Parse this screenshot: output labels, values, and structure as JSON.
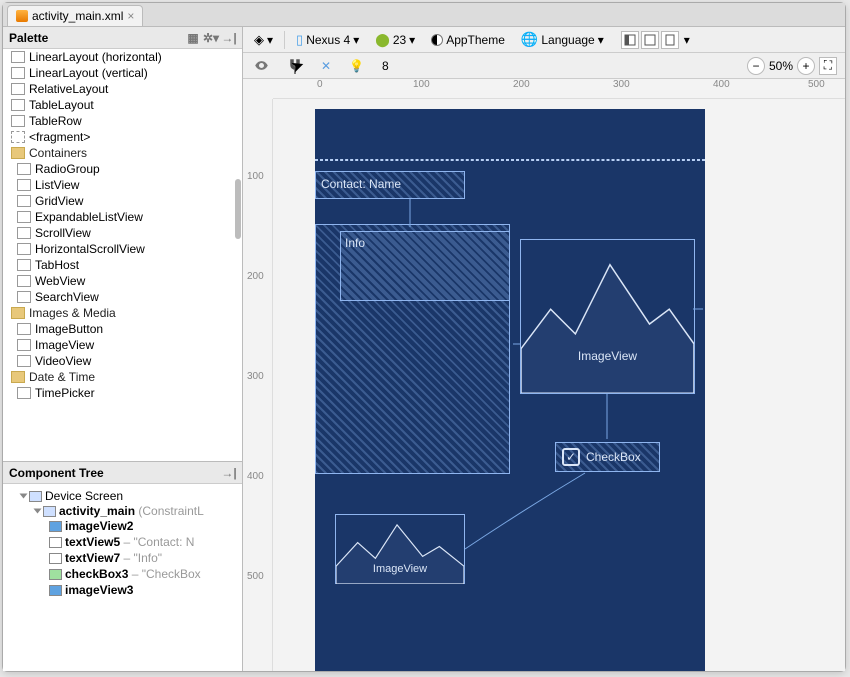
{
  "tab": {
    "filename": "activity_main.xml"
  },
  "palette": {
    "title": "Palette",
    "items": [
      {
        "label": "LinearLayout (horizontal)",
        "icon": "layout"
      },
      {
        "label": "LinearLayout (vertical)",
        "icon": "layout"
      },
      {
        "label": "RelativeLayout",
        "icon": "layout"
      },
      {
        "label": "TableLayout",
        "icon": "layout"
      },
      {
        "label": "TableRow",
        "icon": "layout"
      },
      {
        "label": "<fragment>",
        "icon": "dev"
      }
    ],
    "groups": [
      {
        "group": "Containers",
        "items": [
          "RadioGroup",
          "ListView",
          "GridView",
          "ExpandableListView",
          "ScrollView",
          "HorizontalScrollView",
          "TabHost",
          "WebView",
          "SearchView"
        ]
      },
      {
        "group": "Images & Media",
        "items": [
          "ImageButton",
          "ImageView",
          "VideoView"
        ]
      },
      {
        "group": "Date & Time",
        "items": [
          "TimePicker"
        ]
      }
    ]
  },
  "toolbar": {
    "device": "Nexus 4",
    "api": "23",
    "theme": "AppTheme",
    "language": "Language",
    "autoconnect_margin": "8",
    "zoom": "50%"
  },
  "component_tree": {
    "title": "Component Tree",
    "root": "Device Screen",
    "layout": "activity_main",
    "layout_type": "(ConstraintL",
    "children": [
      {
        "id": "imageView2",
        "type": "img",
        "sub": ""
      },
      {
        "id": "textView5",
        "type": "txt",
        "sub": " – \"Contact: N"
      },
      {
        "id": "textView7",
        "type": "txt",
        "sub": " – \"Info\""
      },
      {
        "id": "checkBox3",
        "type": "chk",
        "sub": " – \"CheckBox"
      },
      {
        "id": "imageView3",
        "type": "img",
        "sub": ""
      }
    ]
  },
  "design": {
    "textview5": "Contact: Name",
    "textview7": "Info",
    "imageview_label": "ImageView",
    "checkbox_label": "CheckBox"
  },
  "ruler": {
    "h": [
      "0",
      "100",
      "200",
      "300",
      "400",
      "500"
    ],
    "v": [
      "100",
      "200",
      "300",
      "400",
      "500"
    ]
  }
}
